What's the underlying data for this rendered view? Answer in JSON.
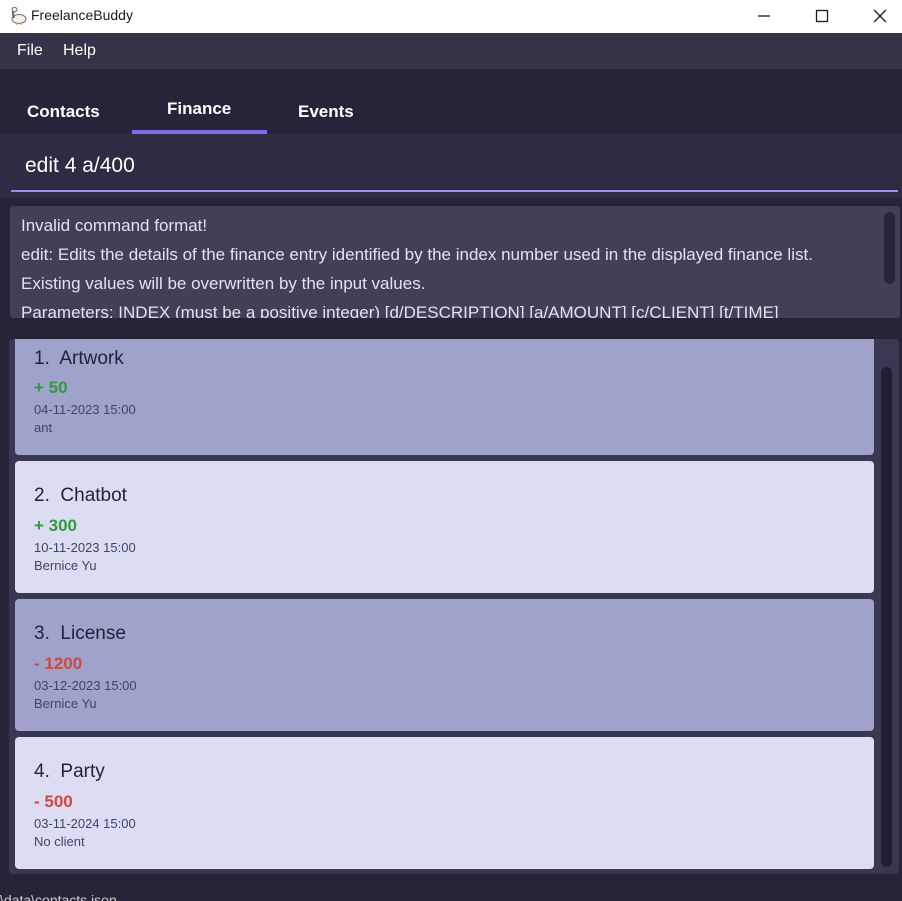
{
  "window": {
    "title": "FreelanceBuddy",
    "app_icon": "goose-icon",
    "controls": [
      "minimize-icon",
      "maximize-icon",
      "close-icon"
    ]
  },
  "menu": {
    "file": "File",
    "help": "Help"
  },
  "tabs": [
    {
      "label": "Contacts"
    },
    {
      "label": "Finance",
      "selected": true
    },
    {
      "label": "Events"
    }
  ],
  "command": {
    "value": "edit 4 a/400"
  },
  "result": {
    "lines": [
      "Invalid command format!",
      "edit: Edits the details of the finance entry identified by the index number used in the displayed finance list.",
      "Existing values will be overwritten by the input values.",
      "Parameters: INDEX (must be a positive integer) [d/DESCRIPTION] [a/AMOUNT] [c/CLIENT] [t/TIME]"
    ]
  },
  "finance": [
    {
      "title": "1.  Artwork",
      "amount": "+ 50",
      "date": "04-11-2023 15:00",
      "client": "ant"
    },
    {
      "title": "2.  Chatbot",
      "amount": "+ 300",
      "date": "10-11-2023 15:00",
      "client": "Bernice Yu"
    },
    {
      "title": "3.  License",
      "amount": "- 1200",
      "date": "03-12-2023 15:00",
      "client": "Bernice Yu"
    },
    {
      "title": "4.  Party",
      "amount": "- 500",
      "date": "03-11-2024 15:00",
      "client": "No client"
    }
  ],
  "colors": {
    "accent": "#7c6ce8",
    "income": "#2e9e3a",
    "expense": "#d2483a"
  },
  "status": {
    "text": "\\data\\contacts.json"
  }
}
